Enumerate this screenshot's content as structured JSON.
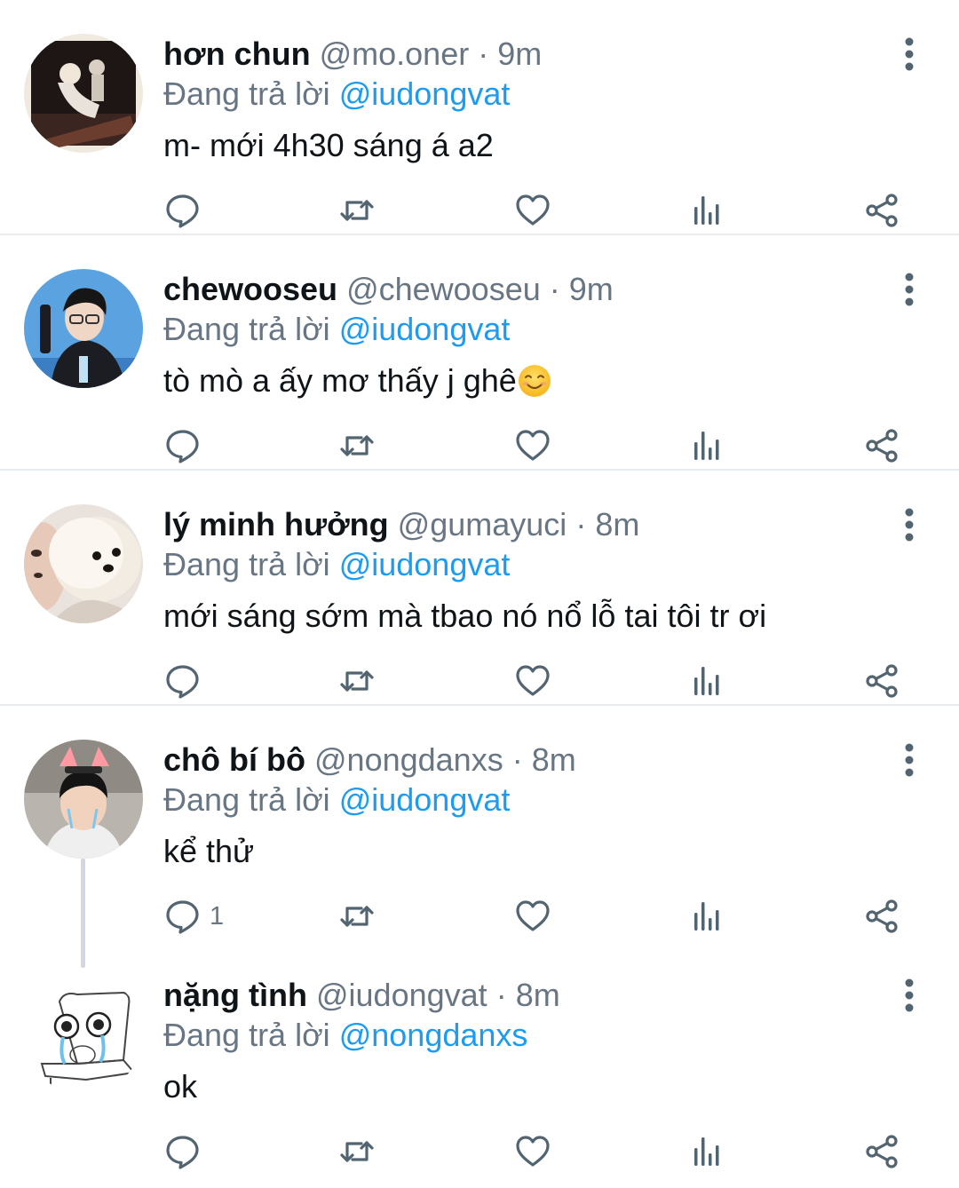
{
  "tweets": [
    {
      "name": "hơn chun",
      "handle": "@mo.oner",
      "time": "9m",
      "reply_prefix": "Đang trả lời",
      "reply_to": "@iudongvat",
      "text": "m- mới 4h30 sáng á a2",
      "reply_count": ""
    },
    {
      "name": "chewooseu",
      "handle": "@chewooseu",
      "time": "9m",
      "reply_prefix": "Đang trả lời",
      "reply_to": "@iudongvat",
      "text": "tò mò a ấy mơ thấy j ghê",
      "reply_count": ""
    },
    {
      "name": "lý minh hưởng",
      "handle": "@gumayuci",
      "time": "8m",
      "reply_prefix": "Đang trả lời",
      "reply_to": "@iudongvat",
      "text": "mới sáng sớm mà tbao nó nổ lỗ tai tôi tr ơi",
      "reply_count": ""
    },
    {
      "name": "chô bí bô",
      "handle": "@nongdanxs",
      "time": "8m",
      "reply_prefix": "Đang trả lời",
      "reply_to": "@iudongvat",
      "text": "kể thử",
      "reply_count": "1"
    },
    {
      "name": "nặng tình",
      "handle": "@iudongvat",
      "time": "8m",
      "reply_prefix": "Đang trả lời",
      "reply_to": "@nongdanxs",
      "text": "ok",
      "reply_count": ""
    }
  ],
  "separator": "·",
  "icons": {
    "reply": "speech-bubble-icon",
    "retweet": "retweet-icon",
    "like": "heart-icon",
    "views": "bar-chart-icon",
    "share": "share-icon",
    "more": "vertical-dots-icon",
    "emoji": "smiling-face-icon"
  },
  "colors": {
    "link": "#1d9bf0",
    "muted": "#687684",
    "text": "#0f1419",
    "divider": "#e9ecee"
  }
}
